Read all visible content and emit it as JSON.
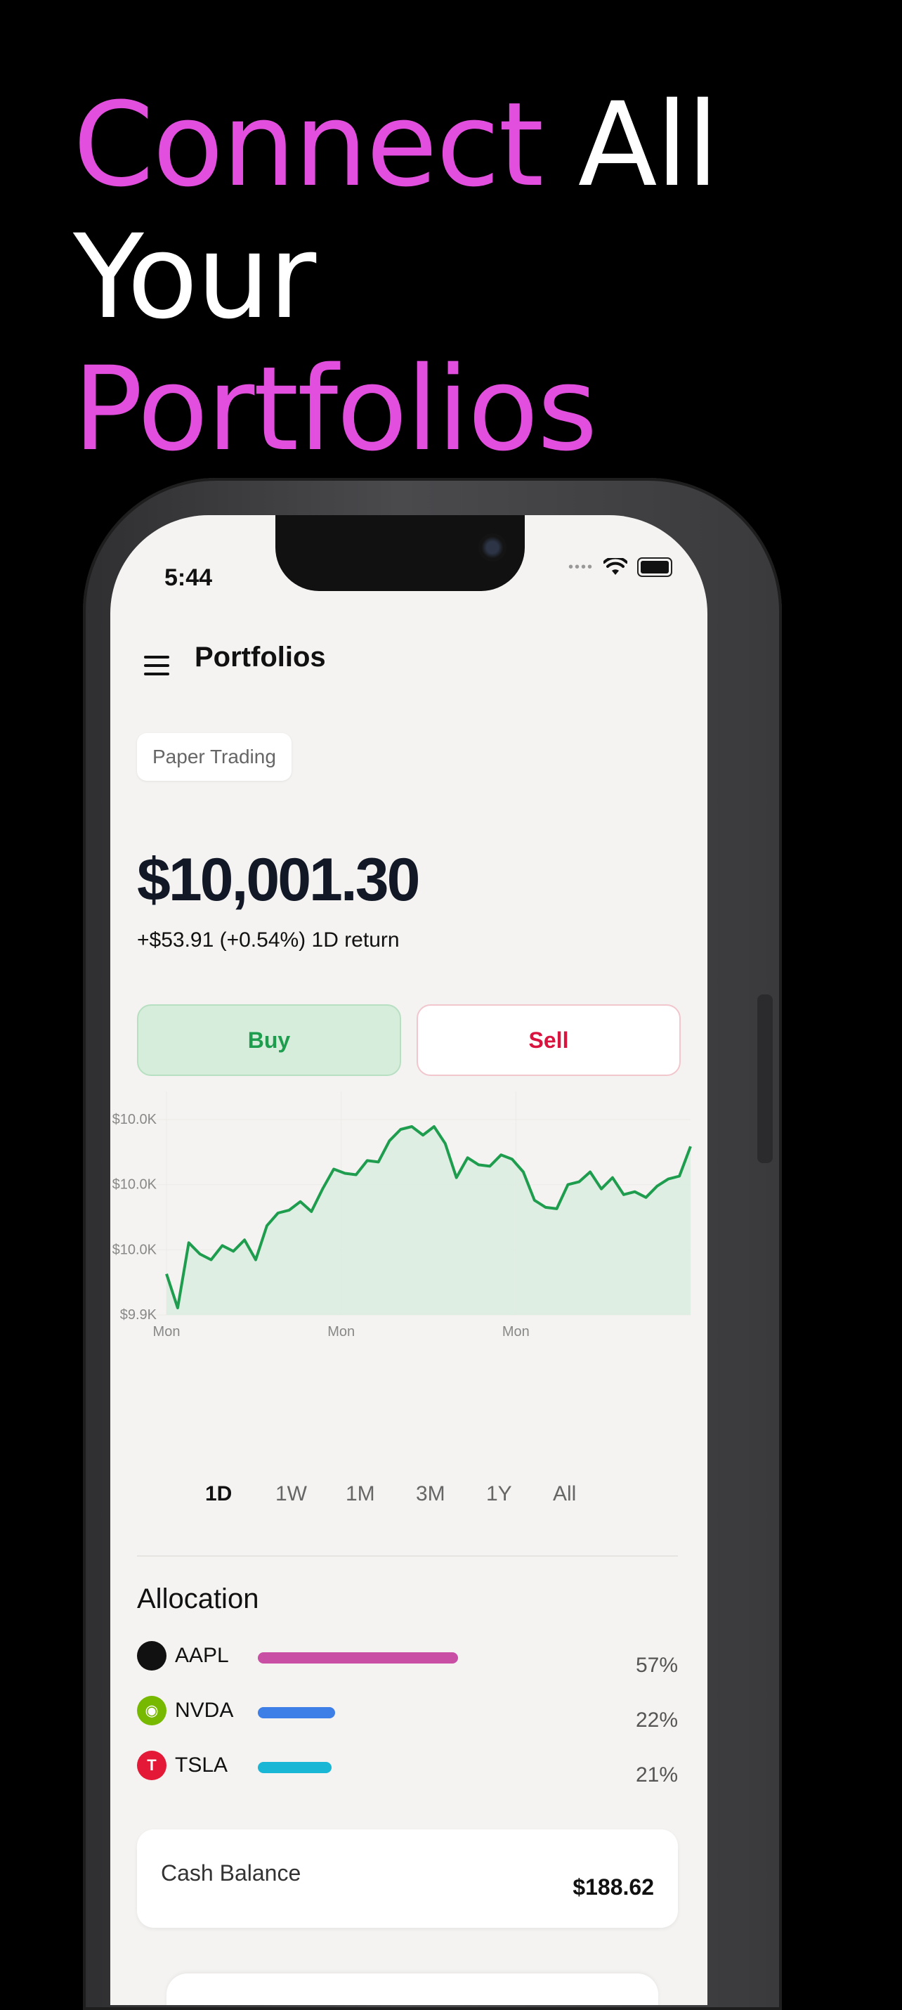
{
  "headline": {
    "word1": "Connect",
    "word2": "All",
    "line2": "Your",
    "line3": "Portfolios"
  },
  "colors": {
    "accent_pink": "#E24EDD",
    "buy_green": "#1f9d4f",
    "sell_red": "#d8143f",
    "chart_line": "#1f9d4f",
    "chart_fill": "#d9ecdf"
  },
  "status_bar": {
    "time": "5:44"
  },
  "header": {
    "title": "Portfolios"
  },
  "account_chip": {
    "label": "Paper Trading"
  },
  "summary": {
    "balance": "$10,001.30",
    "return_text": "+$53.91 (+0.54%) 1D return"
  },
  "actions": {
    "buy_label": "Buy",
    "sell_label": "Sell"
  },
  "chart_data": {
    "type": "area",
    "title": "",
    "y_tick_labels": [
      "$10.0K",
      "$10.0K",
      "$10.0K",
      "$9.9K"
    ],
    "x_tick_labels": [
      "Mon",
      "Mon",
      "Mon"
    ],
    "values": [
      9936,
      9912,
      9958,
      9950,
      9946,
      9956,
      9952,
      9960,
      9946,
      9970,
      9979,
      9981,
      9987,
      9980,
      9996,
      10010,
      10007,
      10006,
      10016,
      10015,
      10030,
      10038,
      10040,
      10034,
      10040,
      10028,
      10004,
      10018,
      10013,
      10012,
      10020,
      10017,
      10008,
      9988,
      9983,
      9982,
      9999,
      10001,
      10008,
      9996,
      10004,
      9992,
      9994,
      9990,
      9998,
      10003,
      10005,
      10026
    ],
    "grid": true
  },
  "range_tabs": [
    "1D",
    "1W",
    "1M",
    "3M",
    "1Y",
    "All"
  ],
  "range_selected": "1D",
  "allocation": {
    "title": "Allocation",
    "items": [
      {
        "symbol": "AAPL",
        "pct": "57%",
        "fraction": 0.57,
        "color": "#C94FA4",
        "logo_bg": "#111111",
        "logo_glyph": ""
      },
      {
        "symbol": "NVDA",
        "pct": "22%",
        "fraction": 0.22,
        "color": "#3D7FE6",
        "logo_bg": "#76B900",
        "logo_glyph": "◉"
      },
      {
        "symbol": "TSLA",
        "pct": "21%",
        "fraction": 0.21,
        "color": "#19B6D6",
        "logo_bg": "#E31937",
        "logo_glyph": "T"
      }
    ]
  },
  "cash": {
    "label": "Cash Balance",
    "value": "$188.62"
  }
}
